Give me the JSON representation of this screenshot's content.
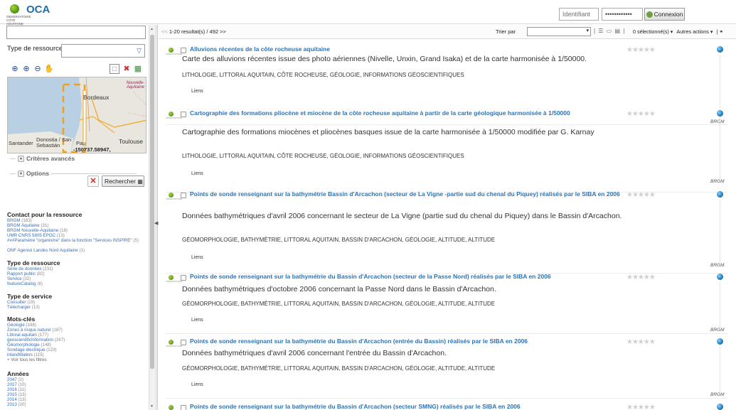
{
  "header": {
    "logo": {
      "name": "OCA",
      "subtitle": "OBSERVATOIRE CÔTE AQUITAINE"
    },
    "login": {
      "username_placeholder": "Identifiant",
      "password_value": "••••••••••••",
      "button": "Connexion"
    }
  },
  "sidebar": {
    "type_label": "Type de ressource:",
    "map": {
      "labels": [
        "Bordeaux",
        "Nouvelle-Aquitaine",
        "Santander",
        "Donostia / San Sebastián",
        "Pau",
        "Toulouse"
      ],
      "coordinates": "-150737.58947, 5705491.59083"
    },
    "advanced": "Critères avancés",
    "options": "Options",
    "search_button": "Rechercher",
    "facets": [
      {
        "title": "Contact pour la ressource",
        "items": [
          {
            "label": "BRGM",
            "count": "(183)"
          },
          {
            "label": "BRGM Aquitaine",
            "count": "(31)"
          },
          {
            "label": "BRGM Nouvelle-Aquitaine",
            "count": "(18)"
          },
          {
            "label": "UMR CNRS 5805 EPOC",
            "count": "(13)"
          },
          {
            "label": "###Paramètre \"organisme\" dans la fonction \"Services INSPIRE\"",
            "count": "(5)"
          },
          {
            "label": "ONF Agence Landes Nord Aquitaine",
            "count": "(1)"
          }
        ]
      },
      {
        "title": "Type de ressource",
        "items": [
          {
            "label": "Série de données",
            "count": "(231)"
          },
          {
            "label": "Rapport public",
            "count": "(82)"
          },
          {
            "label": "Service",
            "count": "(32)"
          },
          {
            "label": "featureCatalog",
            "count": "(8)"
          }
        ]
      },
      {
        "title": "Type de service",
        "items": [
          {
            "label": "Consulter",
            "count": "(19)"
          },
          {
            "label": "Télécharger",
            "count": "(13)"
          }
        ]
      },
      {
        "title": "Mots-clés",
        "items": [
          {
            "label": "Géologie",
            "count": "(198)"
          },
          {
            "label": "Zones à risque naturel",
            "count": "(187)"
          },
          {
            "label": "Littoral aquitain",
            "count": "(177)"
          },
          {
            "label": "geoscientificInformation",
            "count": "(167)"
          },
          {
            "label": "Géomorphologie",
            "count": "(148)"
          },
          {
            "label": "Sondage électrique",
            "count": "(123)"
          },
          {
            "label": "inlandWaters",
            "count": "(115)"
          }
        ],
        "more": "+ Voir tous les filtres"
      },
      {
        "title": "Années",
        "items": [
          {
            "label": "2047",
            "count": "(2)"
          },
          {
            "label": "2017",
            "count": "(10)"
          },
          {
            "label": "2016",
            "count": "(11)"
          },
          {
            "label": "2015",
            "count": "(13)"
          },
          {
            "label": "2014",
            "count": "(13)"
          },
          {
            "label": "2013",
            "count": "(20)"
          }
        ]
      }
    ]
  },
  "toolbar": {
    "result_count": "1-20 resultat(s) / 492",
    "prev": "<<",
    "next": ">>",
    "sort_label": "Trier par",
    "selected": "0 sélectionné(s) ▾",
    "other_actions": "Autres actions ▾",
    "separator": "|"
  },
  "results": [
    {
      "title": "Alluvions récentes de la côte rocheuse aquitaine",
      "abstract": "Carte des alluvions récentes issue des photo aériennes (Nivelle, Unxin, Grand Isaka) et de la carte harmonisée à 1/50000.",
      "keywords": "LITHOLOGIE, LITTORAL AQUITAIN, CÔTE ROCHEUSE, GÉOLOGIE, INFORMATIONS GÉOSCIENTIFIQUES",
      "links": "Liens",
      "org": "BRGM",
      "stars": "★★★★★"
    },
    {
      "title": "Cartographie des formations pliocène et miocène de la côte rocheuse aquitaine à partir de la carte géologique harmonisée à 1/50000",
      "abstract": "Cartographie des formations miocènes et pliocènes basques issue de la carte harmonisée à 1/50000 modifiée par G. Karnay",
      "keywords": "LITHOLOGIE, LITTORAL AQUITAIN, CÔTE ROCHEUSE, GÉOLOGIE, INFORMATIONS GÉOSCIENTIFIQUES",
      "links": "Liens",
      "org": "BRGM",
      "stars": "★★★★★"
    },
    {
      "title": "Points de sonde renseignant sur la bathymétrie Bassin d'Arcachon (secteur de La Vigne -partie sud du chenal du Piquey) réalisés par le SIBA en 2006",
      "abstract": "Données bathymétriques d'avril 2006 concernant le secteur de La Vigne (partie sud du chenal du Piquey) dans le Bassin d'Arcachon.",
      "keywords": "GÉOMORPHOLOGIE, BATHYMÉTRIE, LITTORAL AQUITAIN, BASSIN D'ARCACHON, GÉOLOGIE, ALTITUDE, ALTITUDE",
      "links": "Liens",
      "org": "BRGM",
      "stars": "★★★★★"
    },
    {
      "title": "Points de sonde renseignant sur la bathymétrie du Bassin d'Arcachon (secteur de la Passe Nord) réalisés par le SIBA en 2006",
      "abstract": "Données bathymétriques d'octobre 2006 concernant la Passe Nord dans le Bassin d'Arcachon.",
      "keywords": "GÉOMORPHOLOGIE, BATHYMÉTRIE, LITTORAL AQUITAIN, BASSIN D'ARCACHON, GÉOLOGIE, ALTITUDE, ALTITUDE",
      "links": "Liens",
      "org": "BRGM",
      "stars": "★★★★★"
    },
    {
      "title": "Points de sonde renseignant sur la bathymétrie du Bassin d'Arcachon (entrée du Bassin) réalisés par le SIBA en 2006",
      "abstract": "Données bathymétriques d'avril 2006 concernant l'entrée du Bassin d'Arcachon.",
      "keywords": "GÉOMORPHOLOGIE, BATHYMÉTRIE, LITTORAL AQUITAIN, BASSIN D'ARCACHON, GÉOLOGIE, ALTITUDE, ALTITUDE",
      "links": "Liens",
      "org": "BRGM",
      "stars": "★★★★★"
    },
    {
      "title": "Points de sonde renseignant sur la bathymétrie du Bassin d'Arcachon (secteur SMNG) réalisés par le SIBA en 2006",
      "abstract": "",
      "keywords": "",
      "links": "",
      "org": "",
      "stars": "★★★★★"
    }
  ]
}
